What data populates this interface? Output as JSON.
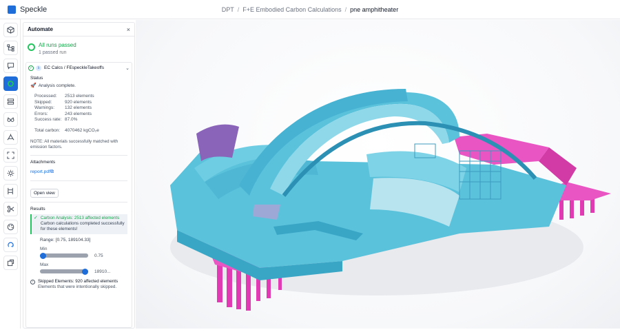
{
  "app": {
    "name": "Speckle"
  },
  "breadcrumb": [
    {
      "label": "DPT"
    },
    {
      "label": "F+E Embodied Carbon Calculations"
    },
    {
      "label": "pne amphitheater"
    }
  ],
  "rail": {
    "icons": [
      "cube-icon",
      "tree-icon",
      "chat-icon",
      "automate-icon",
      "layers-icon",
      "glasses-icon",
      "explode-icon",
      "focus-icon",
      "light-icon",
      "measure-icon",
      "scissors-icon",
      "palette-icon",
      "filter-icon",
      "ellipse-icon"
    ],
    "active_index": 3
  },
  "panel": {
    "title": "Automate",
    "close_label": "×",
    "summary": {
      "title": "All runs passed",
      "subtitle": "1 passed run"
    },
    "function": {
      "name": "EC Calcs / FEspeckleTakeoffs",
      "badge": "λ",
      "status_label": "Status",
      "status_text": "Analysis complete.",
      "stats": [
        {
          "key": "Processed:",
          "value": "2513 elements"
        },
        {
          "key": "Skipped:",
          "value": "920 elements"
        },
        {
          "key": "Warnings:",
          "value": "132 elements"
        },
        {
          "key": "Errors:",
          "value": "243 elements"
        },
        {
          "key": "Success rate:",
          "value": "87.0%"
        }
      ],
      "total": {
        "key": "Total carbon:",
        "value": "4070462 kgCO₂e"
      },
      "note": "NOTE: All materials successfully matched with emission factors.",
      "attachments_label": "Attachments",
      "attachment": "report.pdf",
      "open_view_label": "Open view",
      "results_label": "Results",
      "result": {
        "title": "Carbon Analysis: 2513 affected elements",
        "description": "Carbon calculations completed successfully for these elements!"
      },
      "range": {
        "label": "Range: [0.75, 189104.33]",
        "min_label": "Min",
        "min_value": "0.75",
        "min_position": 0.0,
        "max_label": "Max",
        "max_value": "18910...",
        "max_position": 1.0
      },
      "skipped": {
        "title": "Skipped Elements: 920 affected elements",
        "description": "Elements that were intentionally skipped."
      }
    }
  },
  "colors": {
    "accent": "#1e6dd8",
    "success": "#22c55e",
    "model_cyan": "#5bc2dc",
    "model_magenta": "#e040b6"
  }
}
